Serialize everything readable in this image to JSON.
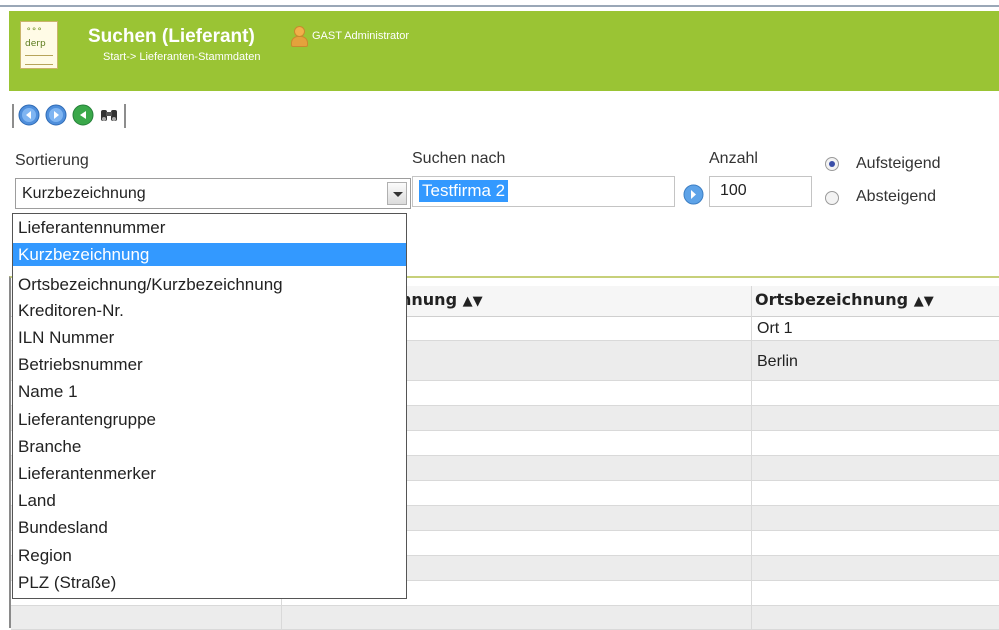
{
  "header": {
    "title": "Suchen (Lieferant)",
    "user": "GAST Administrator",
    "breadcrumb": "Start-> Lieferanten-Stammdaten",
    "logo_text": "derp",
    "accent_color": "#9ac434"
  },
  "toolbar": {
    "buttons": [
      "back-icon",
      "forward-icon",
      "refresh-icon",
      "binoculars-icon"
    ]
  },
  "form": {
    "sort_label": "Sortierung",
    "sort_value": "Kurzbezeichnung",
    "search_label": "Suchen nach",
    "search_value": "Testfirma 2",
    "count_label": "Anzahl",
    "count_value": "100",
    "asc_label": "Aufsteigend",
    "desc_label": "Absteigend",
    "asc_selected": true
  },
  "dropdown": {
    "selected_index": 1,
    "options": [
      "Lieferantennummer",
      "Kurzbezeichnung",
      "Ortsbezeichnung/Kurzbezeichnung",
      "Kreditoren-Nr.",
      "ILN Nummer",
      "Betriebsnummer",
      "Name 1",
      "Lieferantengruppe",
      "Branche",
      "Lieferantenmerker",
      "Land",
      "Bundesland",
      "Region",
      "PLZ (Straße)"
    ]
  },
  "table": {
    "col2_header": "hnung",
    "col3_header": "Ortsbezeichnung",
    "sort_arrows": "▲▼",
    "rows": [
      {
        "ort": "Ort 1"
      },
      {
        "ort": "Berlin"
      }
    ]
  }
}
